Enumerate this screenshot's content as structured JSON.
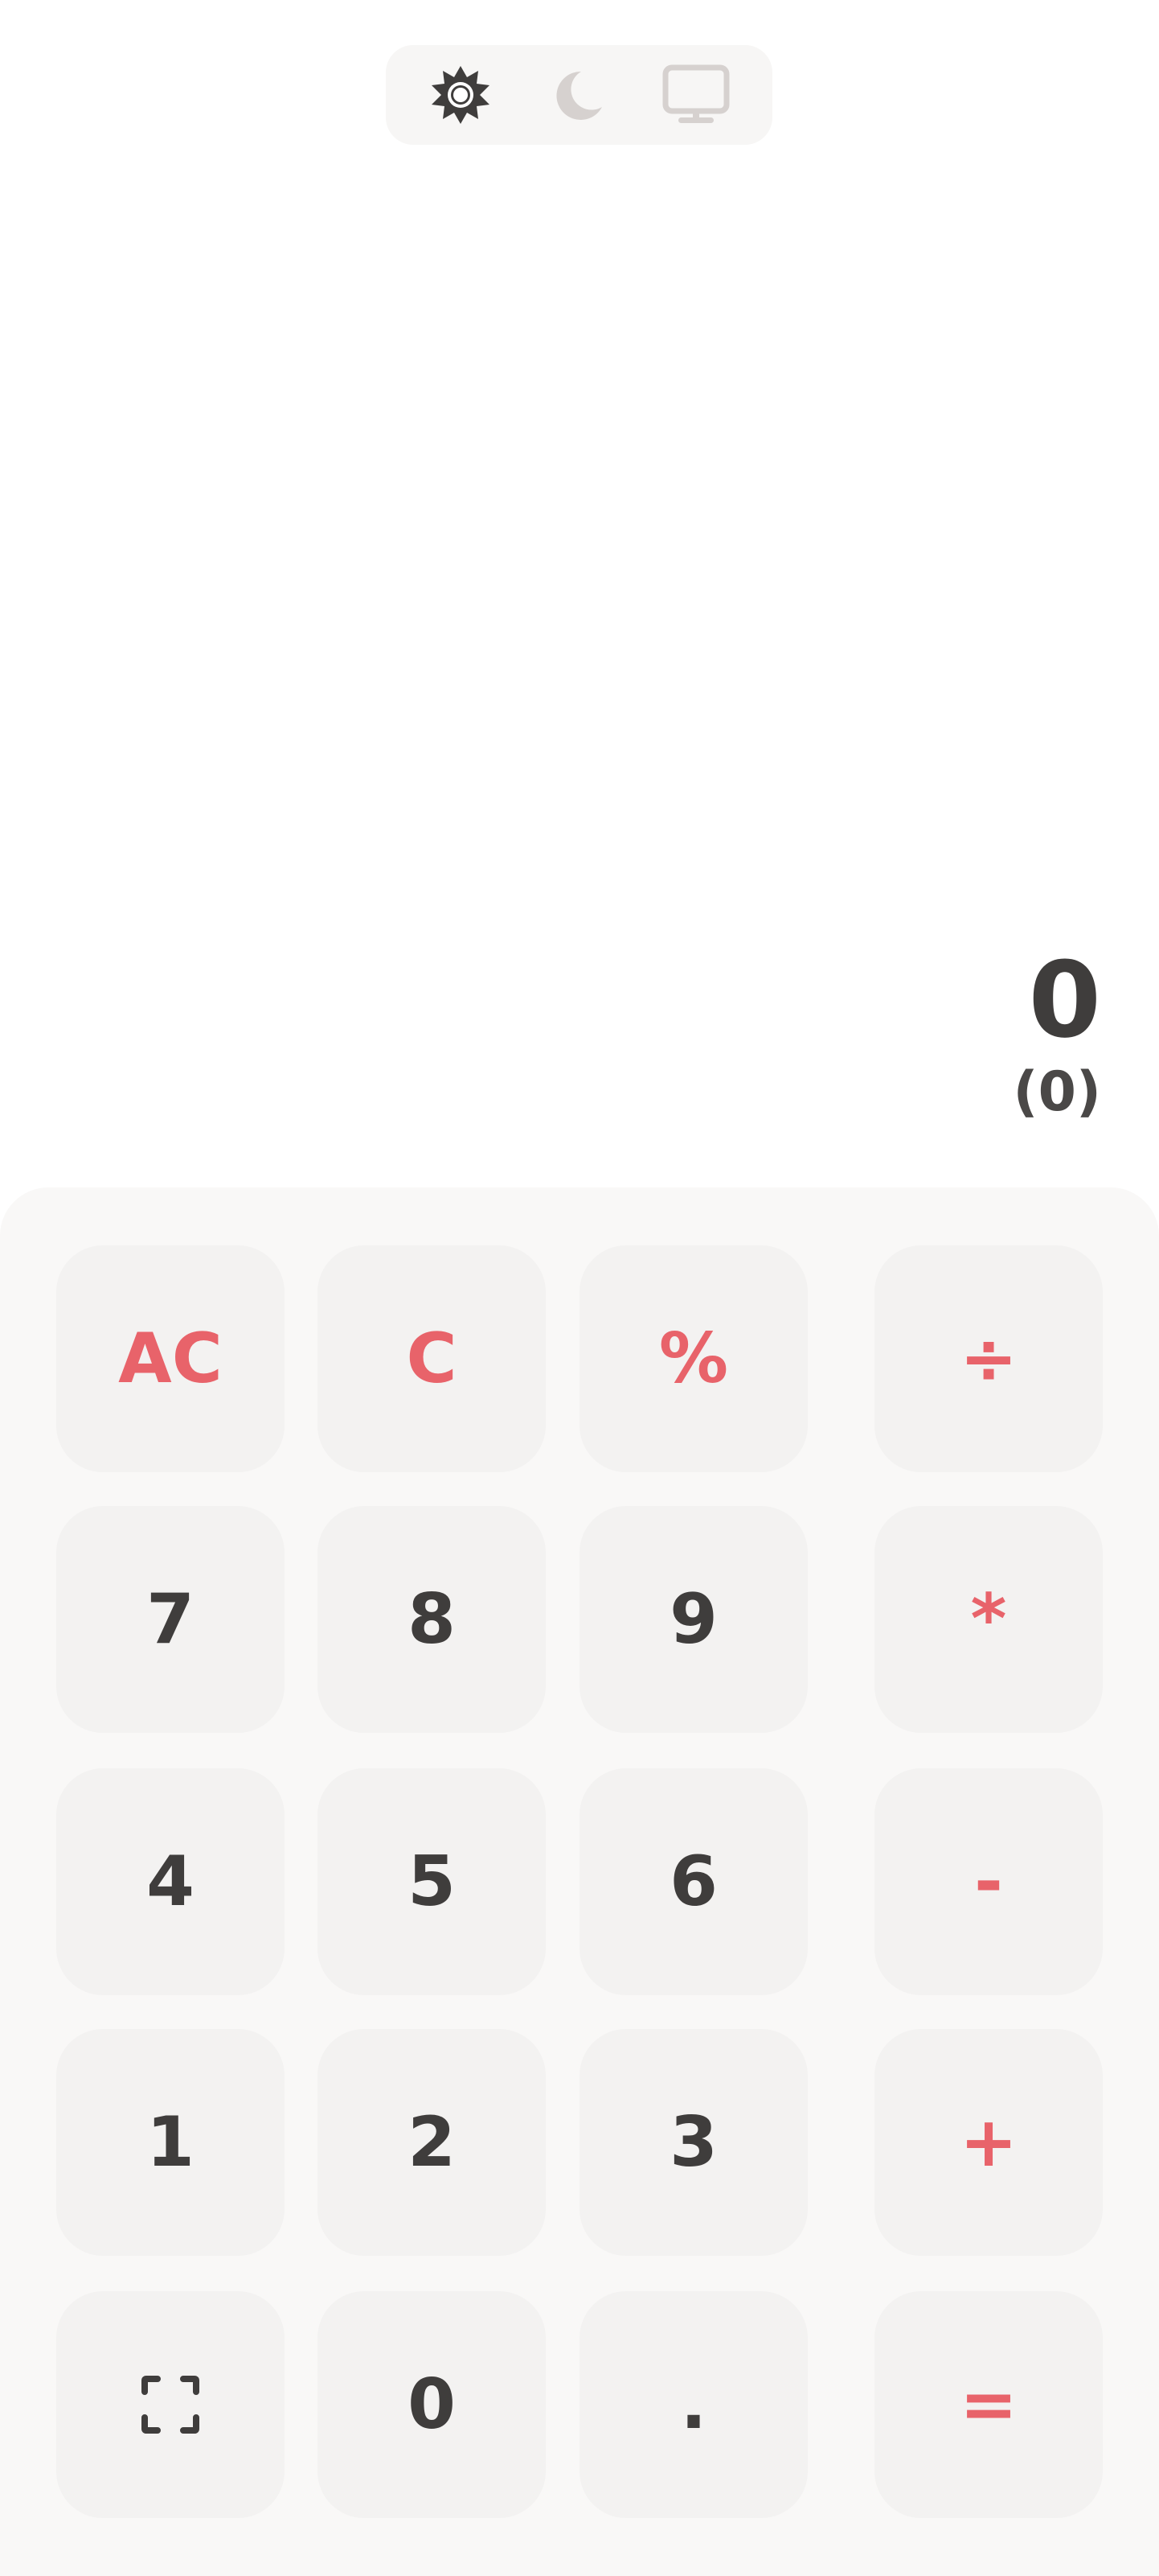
{
  "theme_switcher": {
    "options": [
      {
        "id": "light",
        "icon": "sun-icon",
        "active": true
      },
      {
        "id": "dark",
        "icon": "moon-icon",
        "active": false
      },
      {
        "id": "system",
        "icon": "monitor-icon",
        "active": false
      }
    ]
  },
  "display": {
    "value": "0",
    "secondary": "(0)"
  },
  "keys": {
    "ac": "AC",
    "c": "C",
    "percent": "%",
    "divide": "÷",
    "seven": "7",
    "eight": "8",
    "nine": "9",
    "multiply": "*",
    "four": "4",
    "five": "5",
    "six": "6",
    "minus": "-",
    "one": "1",
    "two": "2",
    "three": "3",
    "plus": "+",
    "fullscreen_icon": "fullscreen-icon",
    "zero": "0",
    "dot": ".",
    "equals": "="
  },
  "colors": {
    "accent": "#e8636a",
    "text": "#3f3d3c",
    "key_background": "#f3f2f1",
    "panel_background": "#f9f8f7",
    "icon_inactive": "#d6d1cf"
  }
}
